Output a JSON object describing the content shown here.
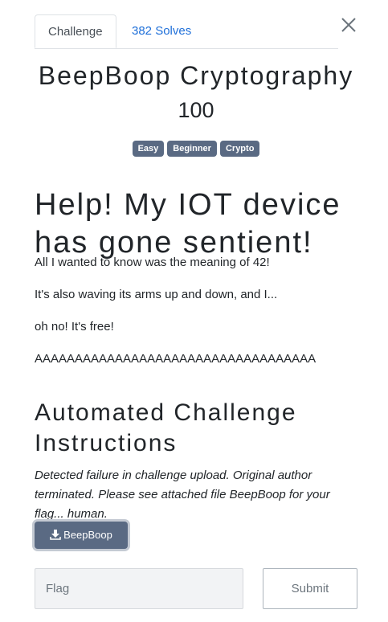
{
  "tabs": {
    "challenge": "Challenge",
    "solves": "382 Solves"
  },
  "challenge": {
    "name": "BeepBoop Cryptography",
    "value": "100",
    "tags": [
      "Easy",
      "Beginner",
      "Crypto"
    ]
  },
  "description": {
    "heading": "Help! My IOT device has gone sentient!",
    "paragraphs": [
      "All I wanted to know was the meaning of 42!",
      "It's also waving its arms up and down, and I...",
      "oh no! It's free!",
      "AAAAAAAAAAAAAAAAAAAAAAAAAAAAAAAAAAA"
    ]
  },
  "instructions": {
    "heading": "Automated Challenge Instructions",
    "text": "Detected failure in challenge upload. Original author terminated. Please see attached file BeepBoop for your flag... human."
  },
  "file": {
    "label": "BeepBoop",
    "icon": "download-icon"
  },
  "form": {
    "flag_placeholder": "Flag",
    "submit_label": "Submit"
  },
  "colors": {
    "tab_link": "#1e6fd9",
    "tag_bg": "#5a6a83",
    "file_btn_bg": "#5a6a83"
  }
}
